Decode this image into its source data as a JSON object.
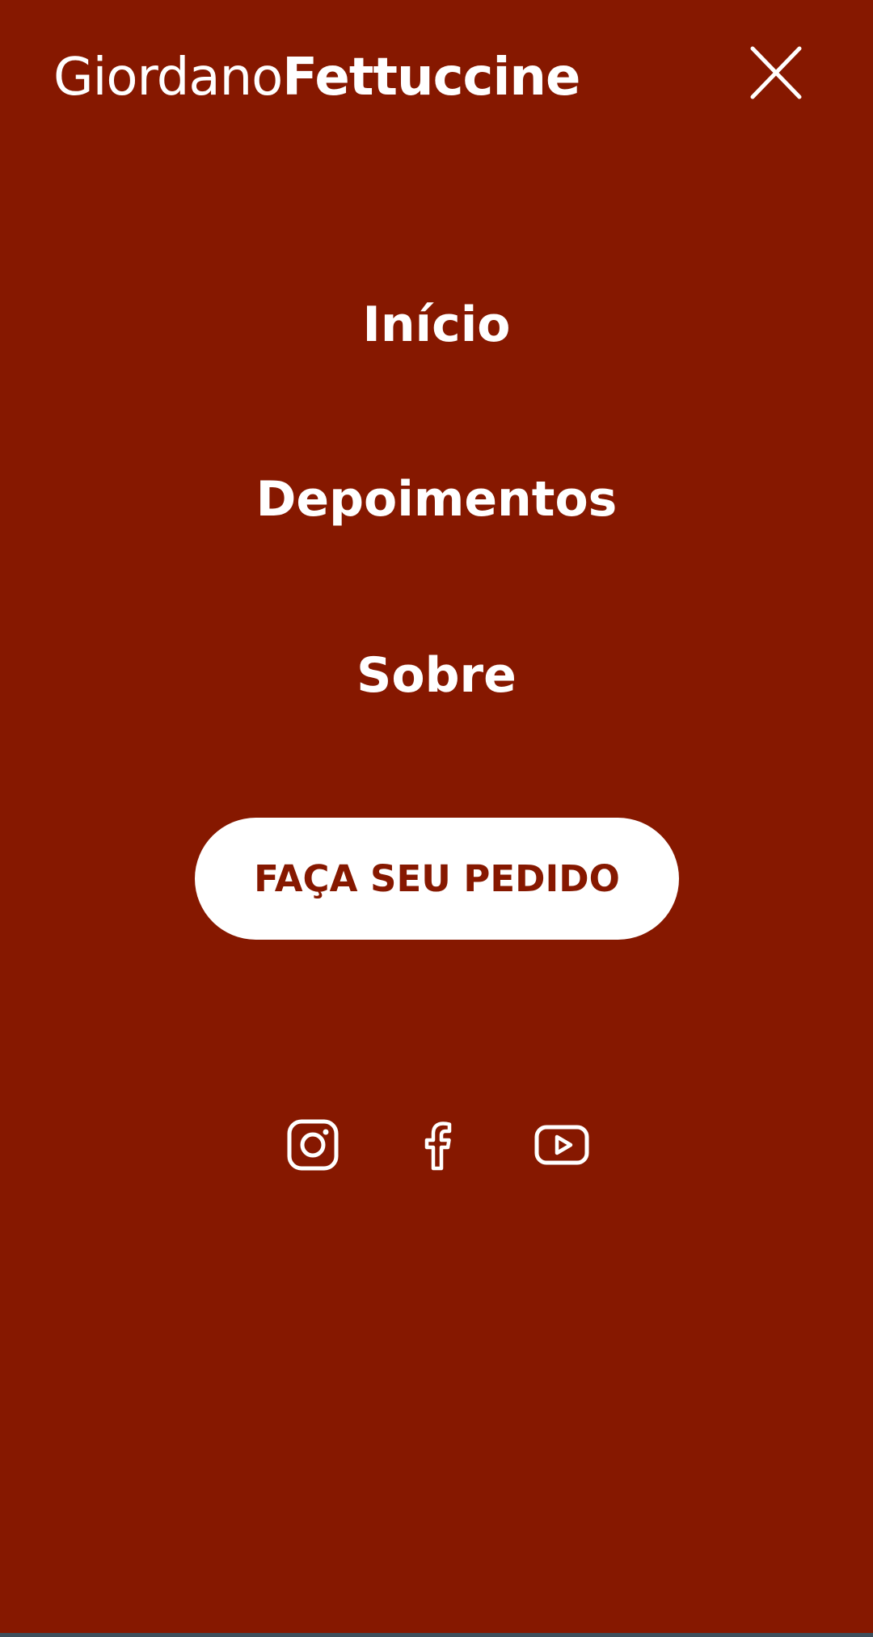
{
  "header": {
    "logo_light": "Giordano",
    "logo_bold": "Fettuccine",
    "close_icon": "close-icon"
  },
  "nav": {
    "items": [
      {
        "label": "Início"
      },
      {
        "label": "Depoimentos"
      },
      {
        "label": "Sobre"
      }
    ]
  },
  "cta": {
    "label": "FAÇA SEU PEDIDO"
  },
  "social": {
    "icons": [
      "instagram-icon",
      "facebook-icon",
      "youtube-icon"
    ]
  },
  "colors": {
    "background": "#861800",
    "text": "#ffffff",
    "button_bg": "#ffffff",
    "button_text": "#861800"
  }
}
